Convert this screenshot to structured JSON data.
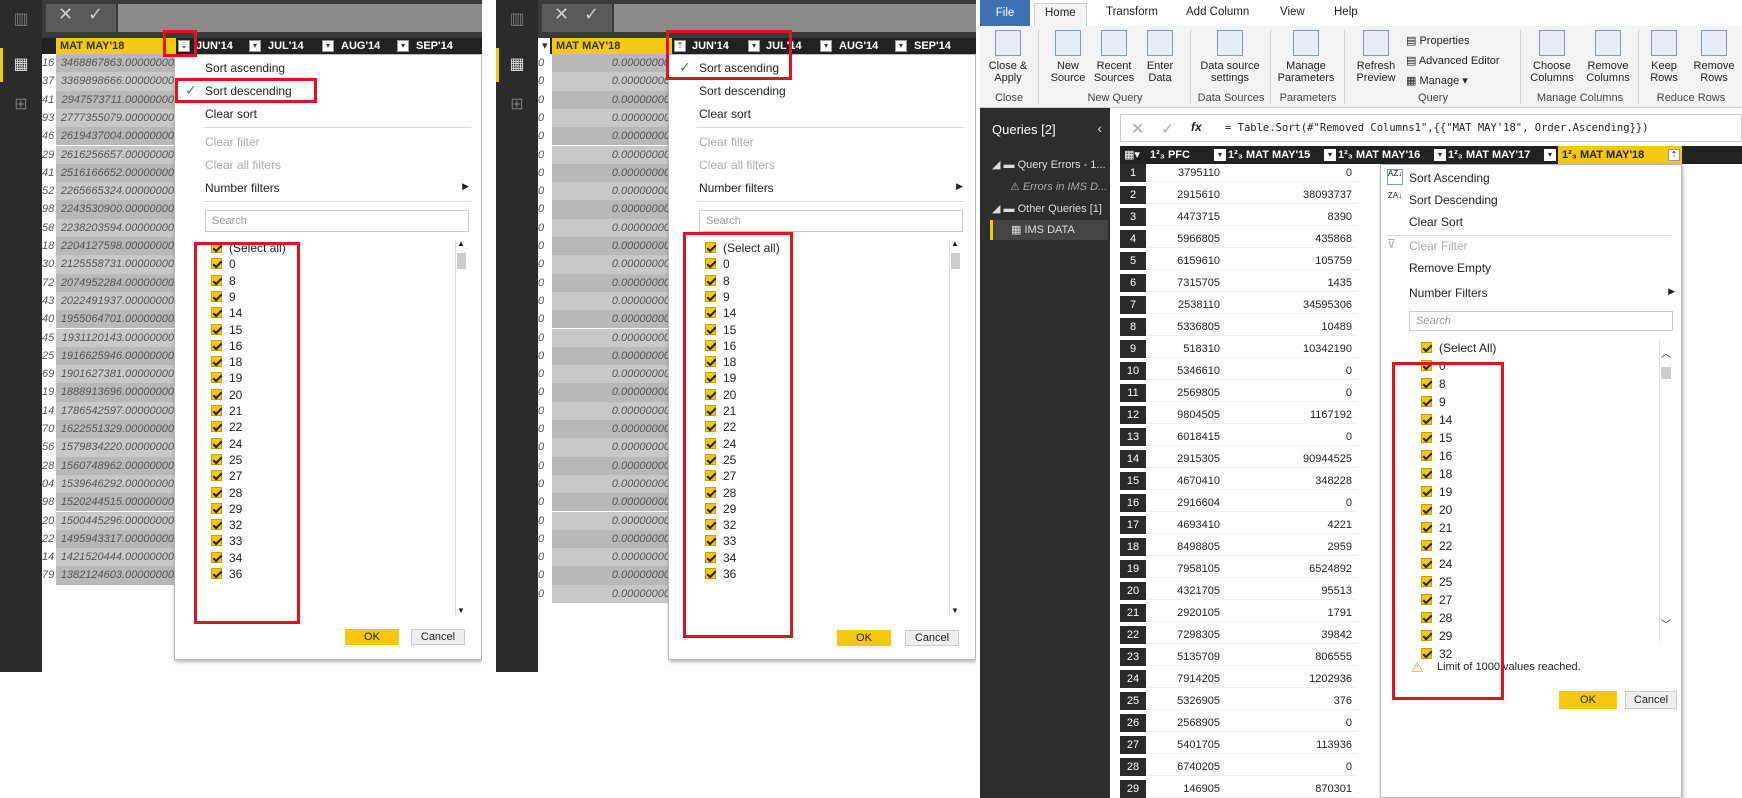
{
  "panel1": {
    "header": [
      "MAT MAY'18",
      "JUN'14",
      "JUL'14",
      "AUG'14",
      "SEP'14"
    ],
    "rows": [
      {
        "n": "16",
        "v": "3468867863.00000000"
      },
      {
        "n": "37",
        "v": "3369898666.00000000"
      },
      {
        "n": "41",
        "v": "2947573711.00000000"
      },
      {
        "n": "93",
        "v": "2777355079.00000000"
      },
      {
        "n": "46",
        "v": "2619437004.00000000"
      },
      {
        "n": "29",
        "v": "2616256657.00000000"
      },
      {
        "n": "41",
        "v": "2516166652.00000000"
      },
      {
        "n": "52",
        "v": "2265665324.00000000"
      },
      {
        "n": "98",
        "v": "2243530900.00000000"
      },
      {
        "n": "58",
        "v": "2238203594.00000000"
      },
      {
        "n": "18",
        "v": "2204127598.00000000"
      },
      {
        "n": "30",
        "v": "2125558731.00000000"
      },
      {
        "n": "72",
        "v": "2074952284.00000000"
      },
      {
        "n": "43",
        "v": "2022491937.00000000"
      },
      {
        "n": "40",
        "v": "1955064701.00000000"
      },
      {
        "n": "45",
        "v": "1931120143.00000000"
      },
      {
        "n": "25",
        "v": "1916625946.00000000"
      },
      {
        "n": "69",
        "v": "1901627381.00000000"
      },
      {
        "n": "19",
        "v": "1888913696.00000000"
      },
      {
        "n": "14",
        "v": "1786542597.00000000"
      },
      {
        "n": "70",
        "v": "1622551329.00000000"
      },
      {
        "n": "56",
        "v": "1579834220.00000000"
      },
      {
        "n": "28",
        "v": "1560748962.00000000"
      },
      {
        "n": "04",
        "v": "1539646292.00000000"
      },
      {
        "n": "98",
        "v": "1520244515.00000000"
      },
      {
        "n": "20",
        "v": "1500445296.00000000"
      },
      {
        "n": "22",
        "v": "1495943317.00000000"
      },
      {
        "n": "14",
        "v": "1421520444.00000000"
      },
      {
        "n": "79",
        "v": "1382124603.00000000"
      }
    ],
    "menu": {
      "sort_asc": "Sort ascending",
      "sort_desc": "Sort descending",
      "clear_sort": "Clear sort",
      "clear_filter": "Clear filter",
      "clear_all": "Clear all filters",
      "number_filters": "Number filters",
      "search_ph": "Search",
      "ok": "OK",
      "cancel": "Cancel"
    },
    "values": [
      "(Select all)",
      "0",
      "8",
      "9",
      "14",
      "15",
      "16",
      "18",
      "19",
      "20",
      "21",
      "22",
      "24",
      "25",
      "27",
      "28",
      "29",
      "32",
      "33",
      "34",
      "36"
    ]
  },
  "panel2": {
    "header": [
      "MAT MAY'18",
      "JUN'14",
      "JUL'14",
      "AUG'14",
      "SEP'14"
    ],
    "row_num": "0",
    "row_val": "0.00000000",
    "menu": {
      "sort_asc": "Sort ascending",
      "sort_desc": "Sort descending",
      "clear_sort": "Clear sort",
      "clear_filter": "Clear filter",
      "clear_all": "Clear all filters",
      "number_filters": "Number filters",
      "search_ph": "Search",
      "ok": "OK",
      "cancel": "Cancel"
    },
    "values": [
      "(Select all)",
      "0",
      "8",
      "9",
      "14",
      "15",
      "16",
      "18",
      "19",
      "20",
      "21",
      "22",
      "24",
      "25",
      "27",
      "28",
      "29",
      "32",
      "33",
      "34",
      "36"
    ]
  },
  "panel3": {
    "tabs": [
      "File",
      "Home",
      "Transform",
      "Add Column",
      "View",
      "Help"
    ],
    "buttons": {
      "close_apply": "Close &\nApply",
      "new_source": "New\nSource",
      "recent_sources": "Recent\nSources",
      "enter_data": "Enter\nData",
      "ds_settings": "Data source\nsettings",
      "manage_params": "Manage\nParameters",
      "refresh": "Refresh\nPreview",
      "properties": "Properties",
      "adv_editor": "Advanced Editor",
      "manage": "Manage",
      "choose_cols": "Choose\nColumns",
      "remove_cols": "Remove\nColumns",
      "keep_rows": "Keep\nRows",
      "remove_rows": "Remove\nRows"
    },
    "groups": [
      "Close",
      "New Query",
      "Data Sources",
      "Parameters",
      "Query",
      "Manage Columns",
      "Reduce Rows"
    ],
    "queries_title": "Queries [2]",
    "query_errors": "Query Errors - 1...",
    "errors_in": "Errors in IMS D...",
    "other_queries": "Other Queries [1]",
    "ims_data": "IMS DATA",
    "formula": "= Table.Sort(#\"Removed Columns1\",{{\"MAT MAY'18\", Order.Ascending}})",
    "fx": "fx",
    "cols": [
      "PFC",
      "MAT MAY'15",
      "MAT MAY'16",
      "MAT MAY'17",
      "MAT MAY'18"
    ],
    "rows": [
      [
        "1",
        "3795110",
        "0"
      ],
      [
        "2",
        "2915610",
        "38093737"
      ],
      [
        "3",
        "4473715",
        "8390"
      ],
      [
        "4",
        "5966805",
        "435868"
      ],
      [
        "5",
        "6159610",
        "105759"
      ],
      [
        "6",
        "7315705",
        "1435"
      ],
      [
        "7",
        "2538110",
        "34595306"
      ],
      [
        "8",
        "5336805",
        "10489"
      ],
      [
        "9",
        "518310",
        "10342190"
      ],
      [
        "10",
        "5346610",
        "0"
      ],
      [
        "11",
        "2569805",
        "0"
      ],
      [
        "12",
        "9804505",
        "1167192"
      ],
      [
        "13",
        "6018415",
        "0"
      ],
      [
        "14",
        "2915305",
        "90944525"
      ],
      [
        "15",
        "4670410",
        "348228"
      ],
      [
        "16",
        "2916604",
        "0"
      ],
      [
        "17",
        "4693410",
        "4221"
      ],
      [
        "18",
        "8498805",
        "2959"
      ],
      [
        "19",
        "7958105",
        "6524892"
      ],
      [
        "20",
        "4321705",
        "95513"
      ],
      [
        "21",
        "2920105",
        "1791"
      ],
      [
        "22",
        "7298305",
        "39842"
      ],
      [
        "23",
        "5135709",
        "806555"
      ],
      [
        "24",
        "7914205",
        "1202936"
      ],
      [
        "25",
        "5326905",
        "376"
      ],
      [
        "26",
        "2568905",
        "0"
      ],
      [
        "27",
        "5401705",
        "113936"
      ],
      [
        "28",
        "6740205",
        "0"
      ],
      [
        "29",
        "146905",
        "870301"
      ]
    ],
    "menu": {
      "sort_asc": "Sort Ascending",
      "sort_desc": "Sort Descending",
      "clear_sort": "Clear Sort",
      "clear_filter": "Clear Filter",
      "remove_empty": "Remove Empty",
      "number_filters": "Number Filters",
      "search_ph": "Search",
      "limit": "Limit of 1000 values reached.",
      "ok": "OK",
      "cancel": "Cancel"
    },
    "values": [
      "(Select All)",
      "0",
      "8",
      "9",
      "14",
      "15",
      "16",
      "18",
      "19",
      "20",
      "21",
      "22",
      "24",
      "25",
      "27",
      "28",
      "29",
      "32"
    ]
  },
  "colors": {
    "accent": "#f2c811",
    "highlight": "#e0141e",
    "dark": "#2b2b2b"
  }
}
